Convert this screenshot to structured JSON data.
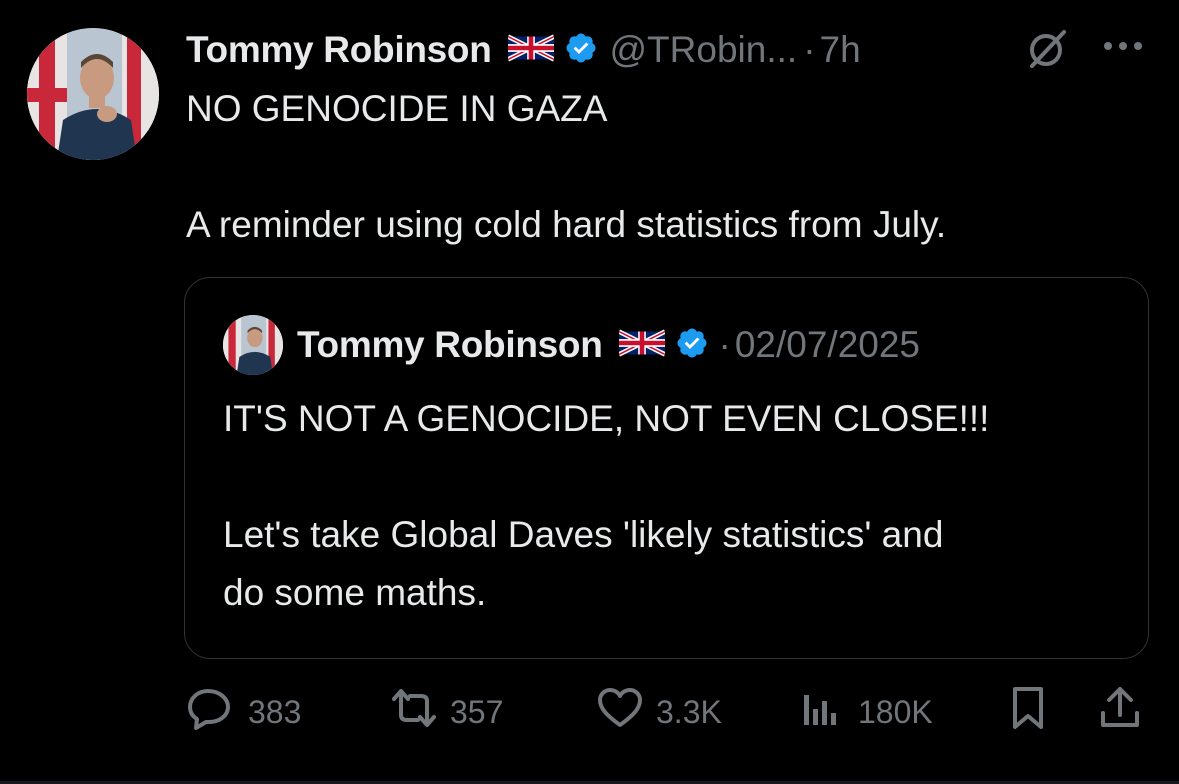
{
  "tweet": {
    "author_name": "Tommy Robinson",
    "handle": "@TRobin...",
    "separator": "·",
    "time": "7h",
    "line1": "NO GENOCIDE IN GAZA",
    "line2": "A reminder using cold hard statistics from July."
  },
  "quote": {
    "author_name": "Tommy Robinson",
    "separator": "·",
    "date": "02/07/2025",
    "line1": "IT'S NOT A GENOCIDE, NOT EVEN CLOSE!!!",
    "line2": "Let's take Global Daves 'likely statistics' and",
    "line3": "do some maths."
  },
  "actions": {
    "replies": "383",
    "reposts": "357",
    "likes": "3.3K",
    "views": "180K"
  },
  "icons": {
    "flag": "uk-flag-icon",
    "verified": "verified-badge-icon",
    "grok": "grok-icon",
    "more": "more-icon",
    "reply": "reply-icon",
    "repost": "repost-icon",
    "like": "heart-icon",
    "views": "views-icon",
    "bookmark": "bookmark-icon",
    "share": "share-icon"
  },
  "colors": {
    "background": "#000000",
    "text": "#e7e9ea",
    "muted": "#71767b",
    "verified": "#1d9bf0",
    "border": "#2f3336"
  }
}
